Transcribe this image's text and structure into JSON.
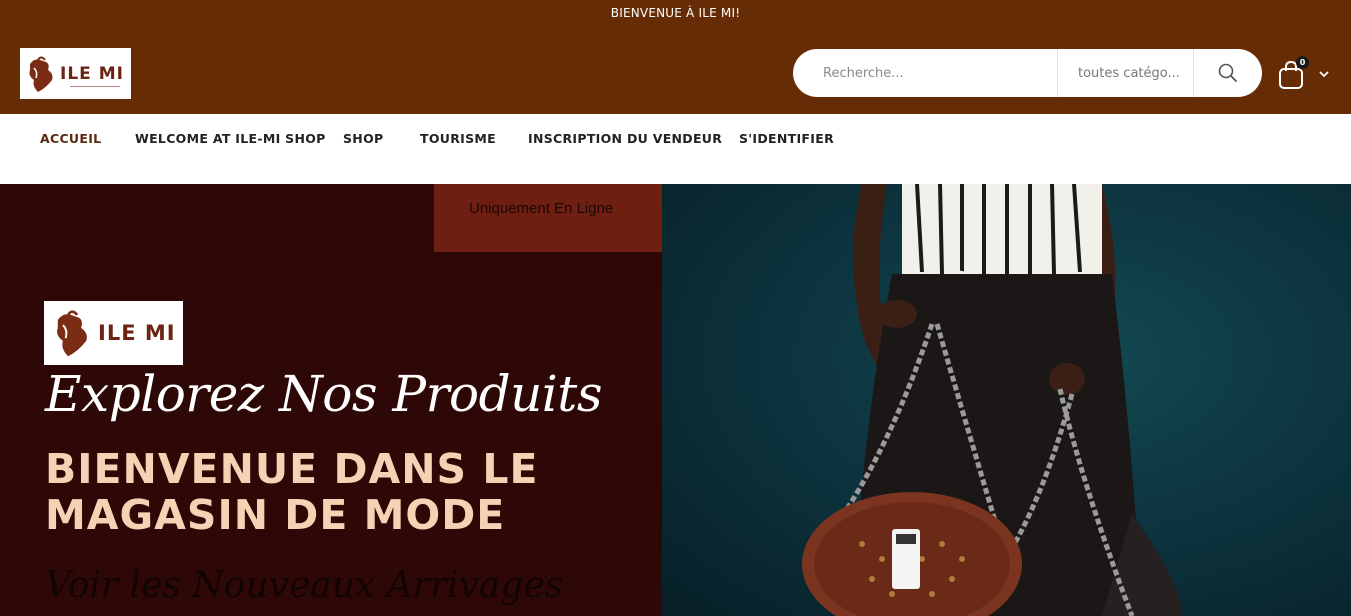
{
  "topbar": {
    "welcome": "BIENVENUE À ILE MI!"
  },
  "logo": {
    "text": "ILE MI"
  },
  "search": {
    "placeholder": "Recherche...",
    "category": "toutes catégo...",
    "icon": "search-icon"
  },
  "cart": {
    "count": "0",
    "icon": "shopping-bag-icon",
    "dropdown_icon": "chevron-down-icon"
  },
  "nav": {
    "items": [
      {
        "label": "ACCUEIL"
      },
      {
        "label": "WELCOME AT ILE-MI SHOP"
      },
      {
        "label": "SHOP"
      },
      {
        "label": "TOURISME"
      },
      {
        "label": "INSCRIPTION DU VENDEUR"
      },
      {
        "label": "S'IDENTIFIER"
      }
    ]
  },
  "hero": {
    "promo": "Uniquement En Ligne",
    "logo_text": "ILE MI",
    "explore": "Explorez Nos Produits",
    "headline_1": "BIENVENUE DANS LE",
    "headline_2": "MAGASIN DE MODE",
    "cta": "Voir les Nouveaux Arrivages"
  },
  "colors": {
    "brand_brown": "#652c06",
    "hero_dark": "#2e0806",
    "promo_red": "#6e1f12",
    "headline_peach": "#f4d3b4",
    "photo_bg": "#0d3540"
  }
}
